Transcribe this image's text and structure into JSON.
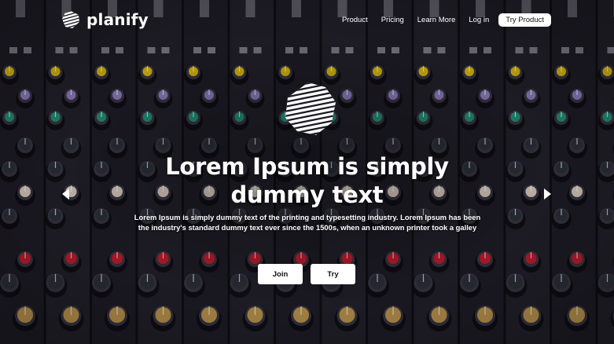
{
  "brand": {
    "name": "planify",
    "logo_icon": "planify-striped-sphere-icon"
  },
  "nav": {
    "items": [
      "Product",
      "Pricing",
      "Learn More",
      "Log in"
    ],
    "cta": "Try Product"
  },
  "hero": {
    "background": "audio-mixing-console-photo",
    "logo_icon": "planify-striped-sphere-icon",
    "title": "Lorem Ipsum is simply dummy text",
    "description": "Lorem Ipsum is simply dummy text of the printing and typesetting industry. Lorem Ipsum has been the industry's standard dummy text ever since the 1500s, when an unknown printer took a galley",
    "buttons": {
      "join": "Join",
      "try": "Try"
    },
    "prev_icon": "arrow-left-icon",
    "next_icon": "arrow-right-icon"
  },
  "colors": {
    "text": "#ffffff",
    "button_bg": "#ffffff",
    "button_text": "#111111"
  }
}
